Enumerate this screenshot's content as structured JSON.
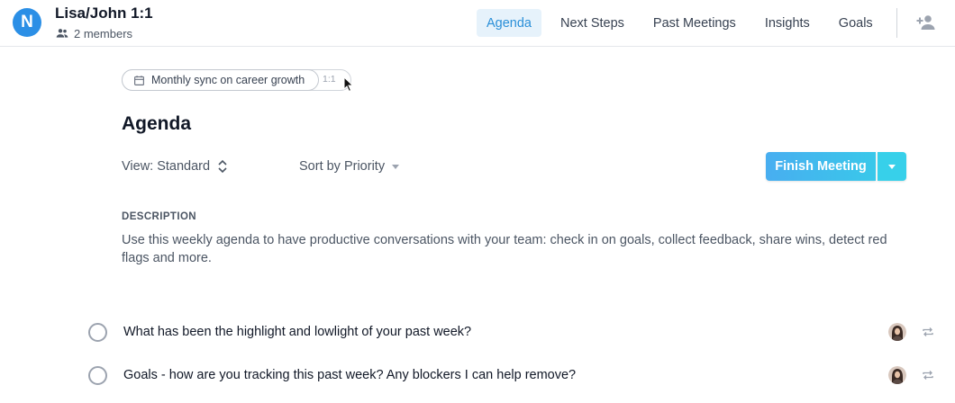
{
  "header": {
    "logo_letter": "N",
    "title": "Lisa/John 1:1",
    "members_label": "2 members",
    "brand_color": "#2b8fe6"
  },
  "tabs": [
    {
      "label": "Agenda",
      "active": true
    },
    {
      "label": "Next Steps",
      "active": false
    },
    {
      "label": "Past Meetings",
      "active": false
    },
    {
      "label": "Insights",
      "active": false
    },
    {
      "label": "Goals",
      "active": false
    }
  ],
  "meeting_chip": {
    "label": "Monthly sync on career growth",
    "tag": "1:1"
  },
  "page": {
    "title": "Agenda",
    "view_label": "View: Standard",
    "sort_label": "Sort by Priority",
    "finish_button": "Finish Meeting",
    "accent_color": "#39c8ea"
  },
  "description": {
    "label": "DESCRIPTION",
    "text": "Use this weekly agenda to have productive conversations with your team: check in on goals, collect feedback, share wins, detect red flags and more."
  },
  "agenda_items": [
    {
      "text": "What has been the highlight and lowlight of your past week?"
    },
    {
      "text": "Goals - how are you tracking this past week? Any blockers I can help remove?"
    }
  ]
}
